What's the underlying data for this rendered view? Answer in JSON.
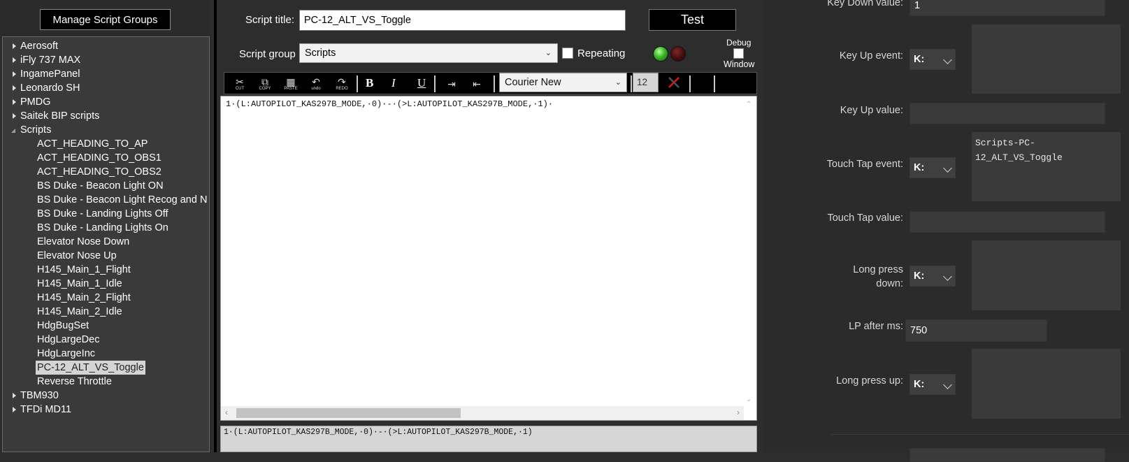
{
  "left": {
    "manage_button": "Manage Script Groups",
    "tree": [
      {
        "label": "Aerosoft",
        "level": 0,
        "expanded": false
      },
      {
        "label": "iFly 737 MAX",
        "level": 0,
        "expanded": false
      },
      {
        "label": "IngamePanel",
        "level": 0,
        "expanded": false
      },
      {
        "label": "Leonardo SH",
        "level": 0,
        "expanded": false
      },
      {
        "label": "PMDG",
        "level": 0,
        "expanded": false
      },
      {
        "label": "Saitek BIP scripts",
        "level": 0,
        "expanded": false
      },
      {
        "label": "Scripts",
        "level": 0,
        "expanded": true
      },
      {
        "label": "ACT_HEADING_TO_AP",
        "level": 1
      },
      {
        "label": "ACT_HEADING_TO_OBS1",
        "level": 1
      },
      {
        "label": "ACT_HEADING_TO_OBS2",
        "level": 1
      },
      {
        "label": "BS Duke - Beacon Light ON",
        "level": 1
      },
      {
        "label": "BS Duke - Beacon Light Recog and N",
        "level": 1
      },
      {
        "label": "BS Duke - Landing Lights Off",
        "level": 1
      },
      {
        "label": "BS Duke - Landing Lights On",
        "level": 1
      },
      {
        "label": "Elevator Nose Down",
        "level": 1
      },
      {
        "label": "Elevator Nose Up",
        "level": 1
      },
      {
        "label": "H145_Main_1_Flight",
        "level": 1
      },
      {
        "label": "H145_Main_1_Idle",
        "level": 1
      },
      {
        "label": "H145_Main_2_Flight",
        "level": 1
      },
      {
        "label": "H145_Main_2_Idle",
        "level": 1
      },
      {
        "label": "HdgBugSet",
        "level": 1
      },
      {
        "label": "HdgLargeDec",
        "level": 1
      },
      {
        "label": "HdgLargeInc",
        "level": 1
      },
      {
        "label": "PC-12_ALT_VS_Toggle",
        "level": 1,
        "selected": true
      },
      {
        "label": "Reverse Throttle",
        "level": 1
      },
      {
        "label": "TBM930",
        "level": 0,
        "expanded": false
      },
      {
        "label": "TFDi MD11",
        "level": 0,
        "expanded": false
      }
    ]
  },
  "editor": {
    "title_label": "Script title:",
    "title_value": "PC-12_ALT_VS_Toggle",
    "test_button": "Test",
    "group_label": "Script group",
    "group_value": "Scripts",
    "repeating_label": "Repeating",
    "debug_label": "Debug",
    "window_label": "Window",
    "toolbar": {
      "cut": "CUT",
      "copy": "COPY",
      "paste": "PASTE",
      "undo": "undo",
      "redo": "REDO",
      "bold": "B",
      "italic": "I",
      "underline": "U",
      "font": "Courier New",
      "size": "12"
    },
    "code": "1·(L:AUTOPILOT_KAS297B_MODE,·0)·-·(>L:AUTOPILOT_KAS297B_MODE,·1)·",
    "preview": "1·(L:AUTOPILOT_KAS297B_MODE,·0)·-·(>L:AUTOPILOT_KAS297B_MODE,·1)"
  },
  "right": {
    "key_down_value_label": "Key Down value:",
    "key_down_value": "1",
    "key_up_event_label": "Key Up event:",
    "key_up_event_k": "K:",
    "key_up_value_label": "Key Up value:",
    "touch_tap_event_label": "Touch Tap event:",
    "touch_tap_event_k": "K:",
    "touch_tap_script": "Scripts-PC-\n12_ALT_VS_Toggle",
    "touch_tap_value_label": "Touch Tap value:",
    "long_press_down_label_1": "Long press",
    "long_press_down_label_2": "down:",
    "long_press_down_k": "K:",
    "lp_after_label": "LP after ms:",
    "lp_after_value": "750",
    "long_press_up_label": "Long press up:",
    "long_press_up_k": "K:"
  },
  "colors": {
    "background": "#2d2d2d",
    "panel": "#3a3a3a",
    "selection": "#d4d4d4"
  }
}
